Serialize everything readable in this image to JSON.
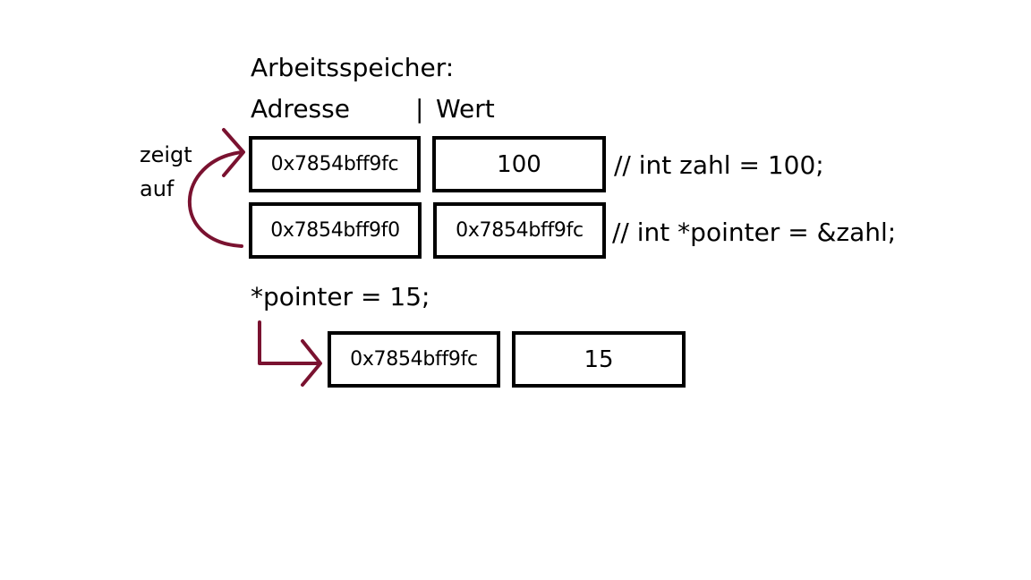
{
  "title": "Arbeitsspeicher:",
  "columns": {
    "address": "Adresse",
    "separator": "|",
    "value": "Wert"
  },
  "arrow_label": {
    "line1": "zeigt",
    "line2": "auf"
  },
  "rows": [
    {
      "address": "0x7854bff9fc",
      "value": "100",
      "comment": "// int zahl = 100;"
    },
    {
      "address": "0x7854bff9f0",
      "value": "0x7854bff9fc",
      "comment": "// int *pointer = &zahl;"
    }
  ],
  "statement": "*pointer = 15;",
  "result": {
    "address": "0x7854bff9fc",
    "value": "15"
  },
  "colors": {
    "arrow": "#7a1230",
    "border": "#000000",
    "text": "#000000"
  }
}
